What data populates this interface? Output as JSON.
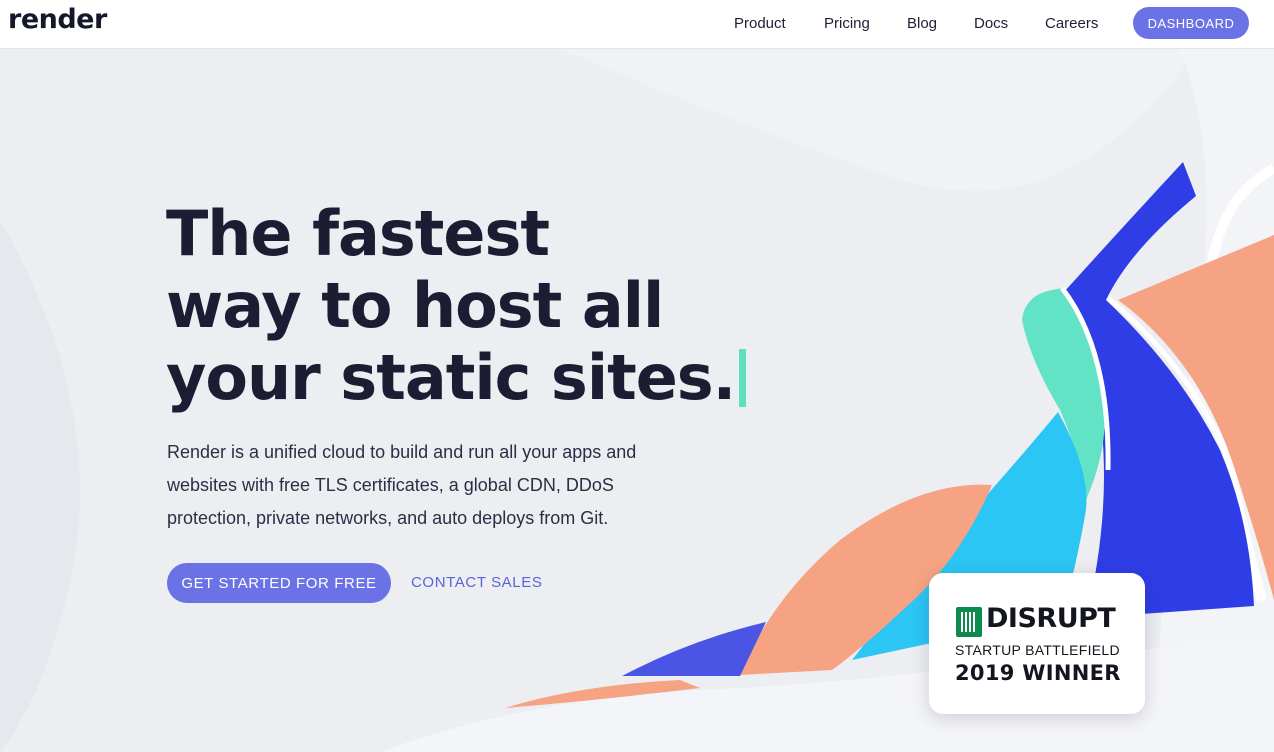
{
  "header": {
    "logo": "render",
    "nav": [
      "Product",
      "Pricing",
      "Blog",
      "Docs",
      "Careers"
    ],
    "dashboard_label": "DASHBOARD"
  },
  "hero": {
    "title_lines": [
      "The fastest",
      "way to host all",
      "your static sites."
    ],
    "description": "Render is a unified cloud to build and run all your apps and websites with free TLS certificates, a global CDN, DDoS protection, private networks, and auto deploys from Git.",
    "cta_primary": "GET STARTED FOR FREE",
    "cta_secondary": "CONTACT SALES"
  },
  "badge": {
    "title": "DISRUPT",
    "subtitle": "STARTUP BATTLEFIELD",
    "year": "2019 WINNER"
  },
  "colors": {
    "accent": "#6b72e5",
    "cursor": "#5ee0bf",
    "blue": "#2f3de6",
    "cyan": "#2cc6f4",
    "salmon": "#f6a383",
    "mint": "#63e3c5"
  },
  "icons": [
    "techcrunch-logo-icon"
  ]
}
